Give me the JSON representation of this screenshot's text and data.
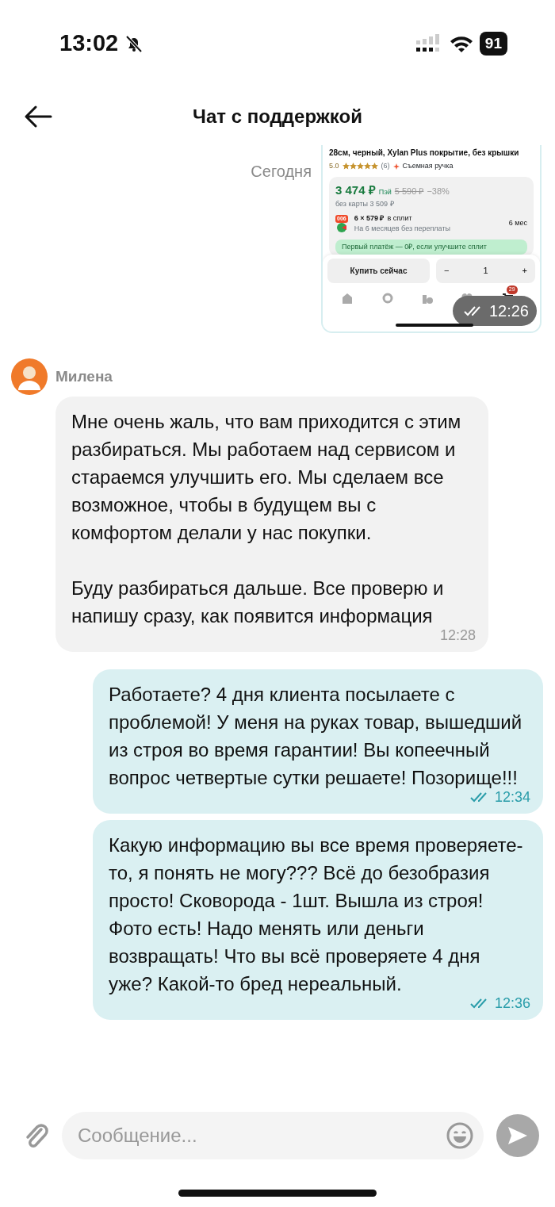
{
  "status_bar": {
    "time": "13:02",
    "battery": "91"
  },
  "header": {
    "title": "Чат с поддержкой"
  },
  "date_separator": "Сегодня",
  "messages": [
    {
      "kind": "screenshot",
      "outgoing": true,
      "read": true,
      "time": "12:26",
      "screenshot": {
        "product_title": "28см, черный, Xylan Plus покрытие, без крышки",
        "rating": "5.0",
        "stars": 5,
        "reviews": "(6)",
        "feature": "Съемная ручка",
        "price": "3 474 ₽",
        "pay_label": "Пэй",
        "old_price": "5 590 ₽",
        "discount": "−38%",
        "price_without_card": "без карты 3 509 ₽",
        "split_badge": "006",
        "split_price": "6 × 579 ₽",
        "split_suffix": "в сплит",
        "split_note": "На 6 месяцев без переплаты",
        "split_term": "6 мес",
        "split_banner": "Первый платёж — 0₽, если улучшите сплит",
        "buy_button": "Купить сейчас",
        "minus": "−",
        "quantity": "1",
        "plus": "+",
        "cart_count": "29"
      }
    },
    {
      "kind": "text",
      "outgoing": false,
      "sender": "Милена",
      "paragraphs": [
        "Мне очень жаль, что вам приходится с этим разбираться. Мы работаем над сервисом и стараемся улучшить его. Мы сделаем все возможное, чтобы в будущем вы с комфортом делали у нас покупки.",
        "Буду разбираться дальше. Все проверю и напишу сразу, как появится информация"
      ],
      "time": "12:28"
    },
    {
      "kind": "text",
      "outgoing": true,
      "read": true,
      "paragraphs": [
        "Работаете? 4 дня клиента посылаете с проблемой! У меня на руках товар, вышедший из строя во время гарантии! Вы копеечный вопрос четвертые сутки решаете! Позорище!!!"
      ],
      "time": "12:34"
    },
    {
      "kind": "text",
      "outgoing": true,
      "read": true,
      "paragraphs": [
        "Какую информацию вы все время проверяете-то, я понять не могу??? Всё до безобразия просто! Сковорода - 1шт. Вышла из строя! Фото есть! Надо менять или деньги возвращать! Что вы всё проверяете 4 дня уже? Какой-то бред нереальный."
      ],
      "time": "12:36"
    }
  ],
  "composer": {
    "placeholder": "Сообщение..."
  }
}
